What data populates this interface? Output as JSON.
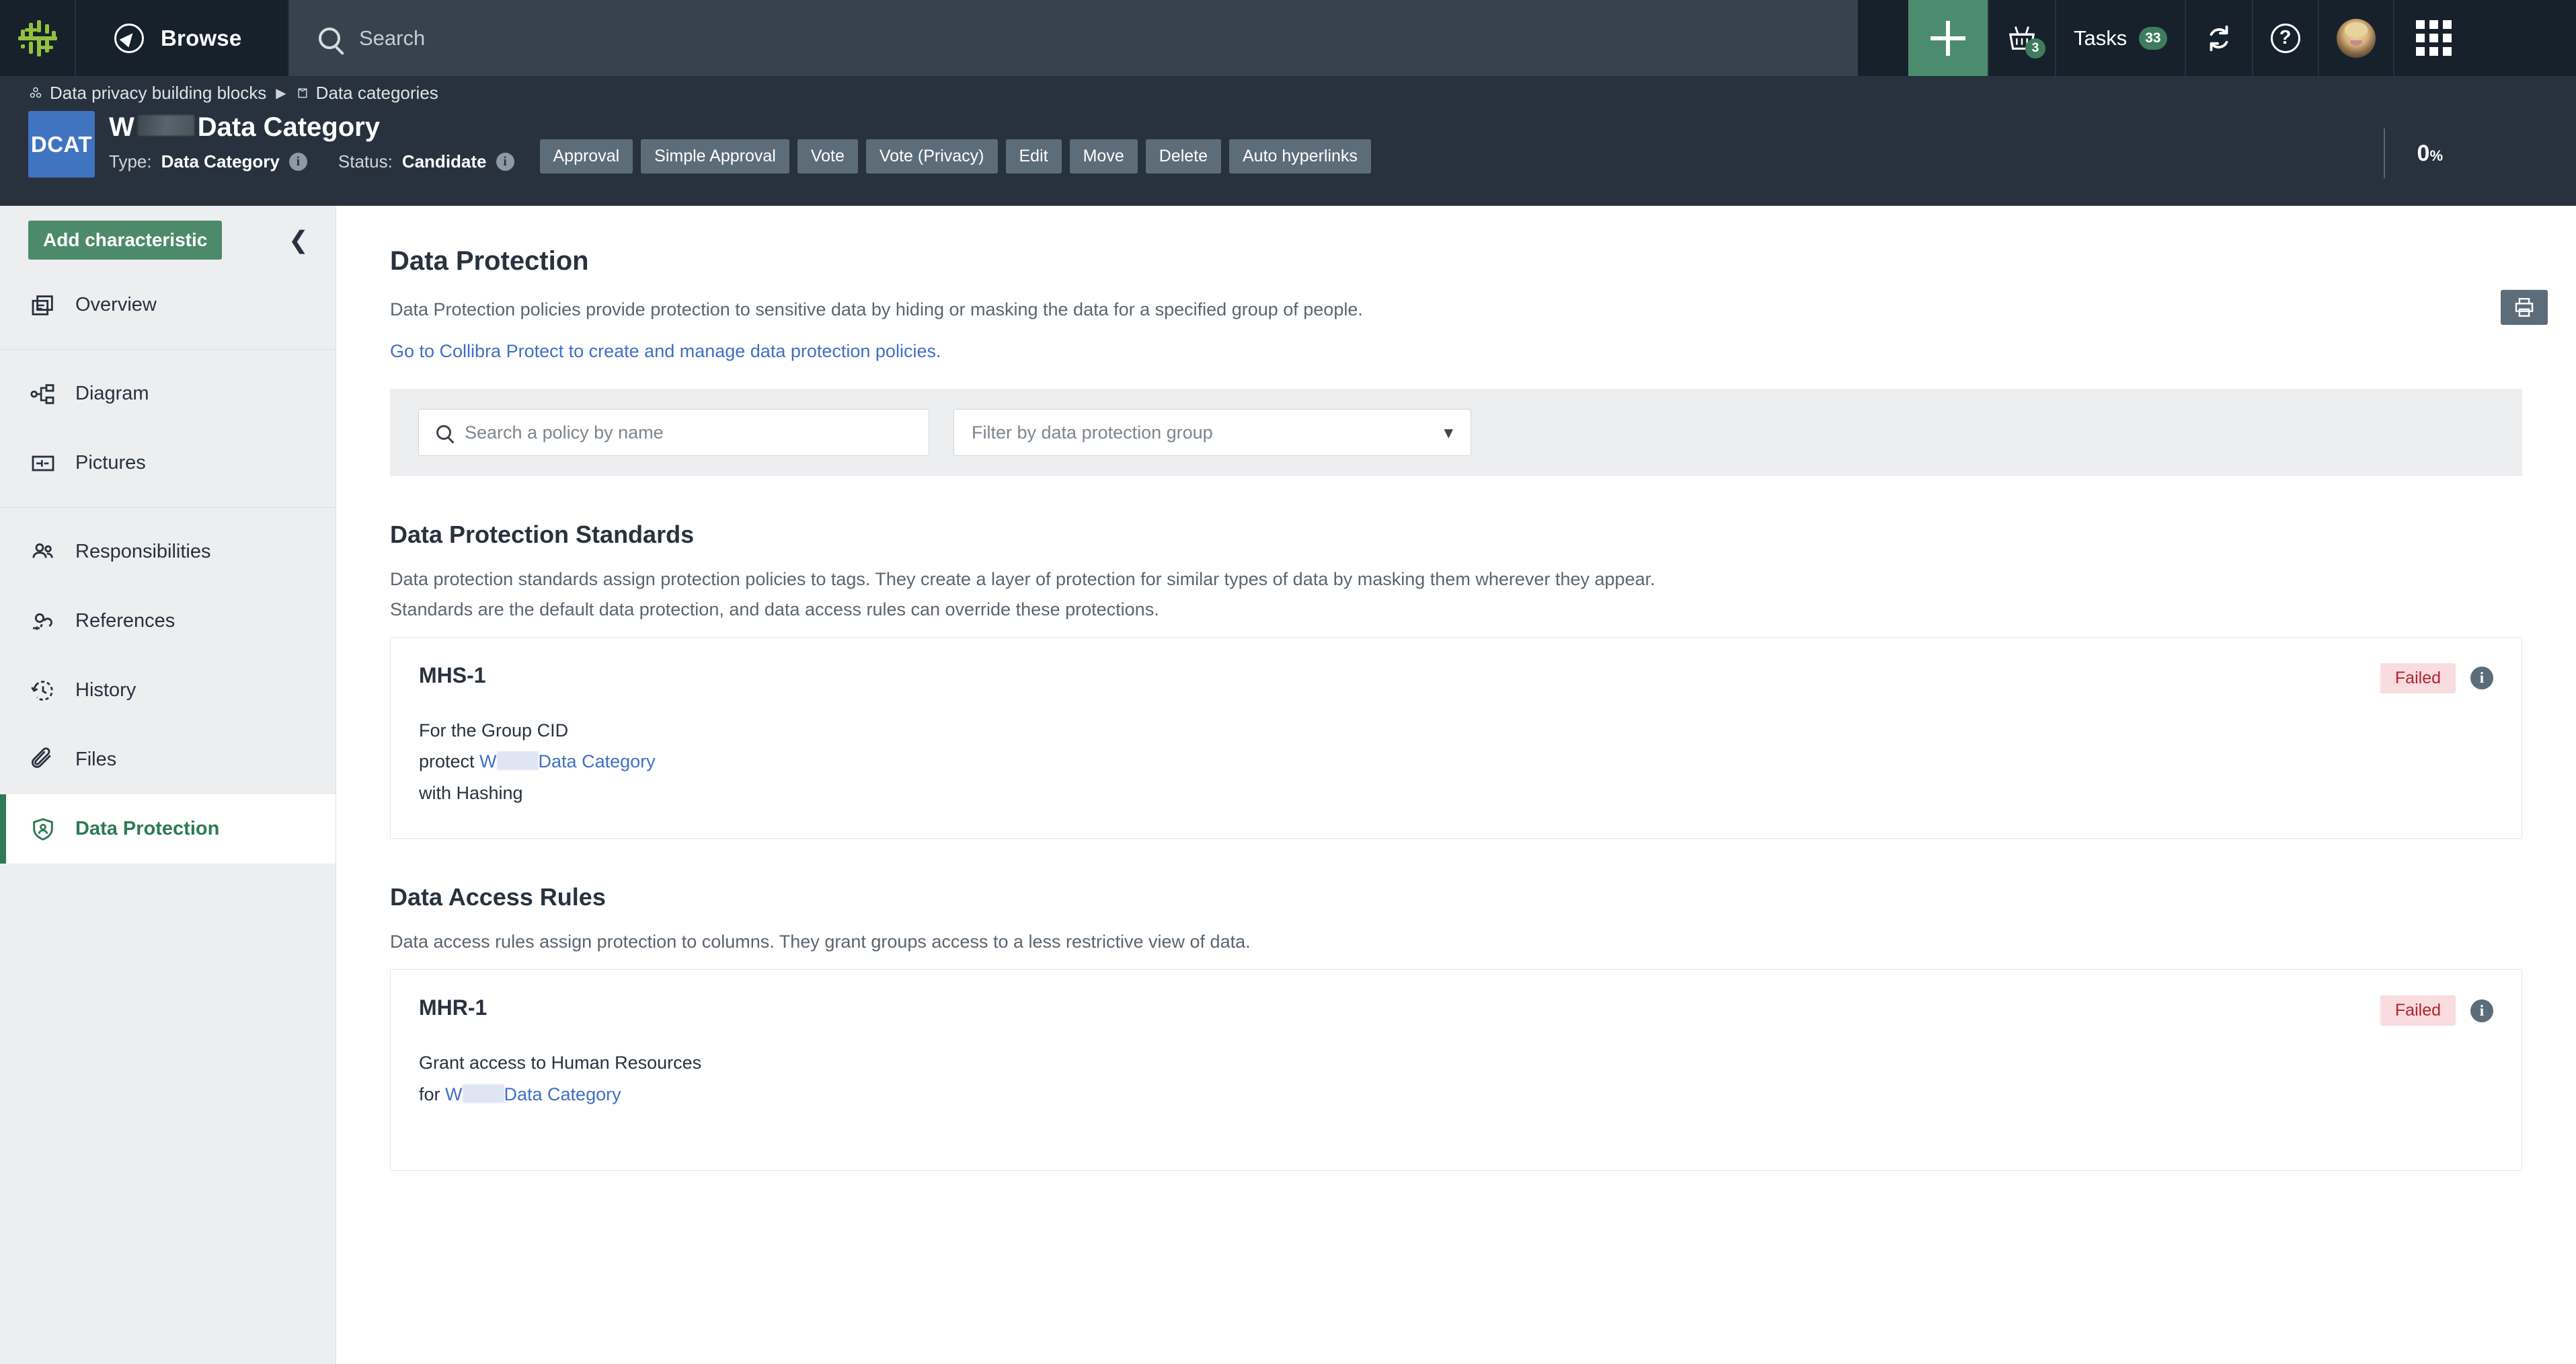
{
  "topnav": {
    "logo_icon": "collibra-logo-icon",
    "browse_label": "Browse",
    "search_placeholder": "Search",
    "plus_label": "+",
    "basket_badge": "3",
    "tasks_label": "Tasks",
    "tasks_badge": "33",
    "help_label": "?",
    "accent_green": "#4c8c6e",
    "badge_green": "#3d7d5e",
    "bar_bg": "#16212b",
    "search_bg": "#36434f"
  },
  "breadcrumb": {
    "items": [
      {
        "label": "Data privacy building blocks",
        "icon": "community-icon"
      },
      {
        "label": "Data categories",
        "icon": "domain-icon"
      }
    ],
    "separator": "▶"
  },
  "subheader": {
    "badge_text": "DCAT",
    "badge_color": "#4074c0",
    "title_prefix": "W",
    "title_suffix": "Data Category",
    "type_key": "Type:",
    "type_value": "Data Category",
    "status_key": "Status:",
    "status_value": "Candidate",
    "progress": "0",
    "progress_unit": "%",
    "print_icon": "print-icon",
    "actions": [
      "Approval",
      "Simple Approval",
      "Vote",
      "Vote (Privacy)",
      "Edit",
      "Move",
      "Delete",
      "Auto hyperlinks"
    ]
  },
  "sidebar": {
    "add_button": "Add characteristic",
    "collapse_icon": "chevron-left-icon",
    "groups": [
      {
        "items": [
          {
            "label": "Overview",
            "icon": "overview-icon"
          }
        ]
      },
      {
        "items": [
          {
            "label": "Diagram",
            "icon": "diagram-icon"
          },
          {
            "label": "Pictures",
            "icon": "pictures-icon"
          }
        ]
      },
      {
        "items": [
          {
            "label": "Responsibilities",
            "icon": "people-icon"
          },
          {
            "label": "References",
            "icon": "link-icon"
          },
          {
            "label": "History",
            "icon": "history-clock-icon"
          },
          {
            "label": "Files",
            "icon": "paperclip-icon"
          },
          {
            "label": "Data Protection",
            "icon": "shield-user-icon",
            "active": true
          }
        ]
      }
    ],
    "active_color": "#2f7a57"
  },
  "main": {
    "title": "Data Protection",
    "description": "Data Protection policies provide protection to sensitive data by hiding or masking the data for a specified group of people.",
    "link": "Go to Collibra Protect to create and manage data protection policies.",
    "filter": {
      "search_placeholder": "Search a policy by name",
      "search_value": "",
      "group_placeholder": "Filter by data protection group",
      "group_value": "",
      "search_icon": "search-icon",
      "chevron_icon": "chevron-down-icon"
    },
    "standards": {
      "title": "Data Protection Standards",
      "description_line1": "Data protection standards assign protection policies to tags. They create a layer of protection for similar types of data by masking them wherever they appear.",
      "description_line2": "Standards are the default data protection, and data access rules can override these protections.",
      "cards": [
        {
          "name": "MHS-1",
          "line1": "For the Group CID",
          "line2_prefix": "protect ",
          "line2_link_prefix": "W",
          "line2_link_suffix": "Data Category",
          "line3": "with Hashing",
          "status": "Failed",
          "status_color": "#b52230",
          "status_bg": "#f8dcdf",
          "info_icon": "info-icon"
        }
      ]
    },
    "access_rules": {
      "title": "Data Access Rules",
      "description": "Data access rules assign protection to columns. They grant groups access to a less restrictive view of data.",
      "cards": [
        {
          "name": "MHR-1",
          "line1": "Grant access to Human Resources",
          "line2_prefix": "for ",
          "line2_link_prefix": "W",
          "line2_link_suffix": "Data Category",
          "status": "Failed",
          "status_color": "#b52230",
          "status_bg": "#f8dcdf",
          "info_icon": "info-icon"
        }
      ]
    }
  }
}
